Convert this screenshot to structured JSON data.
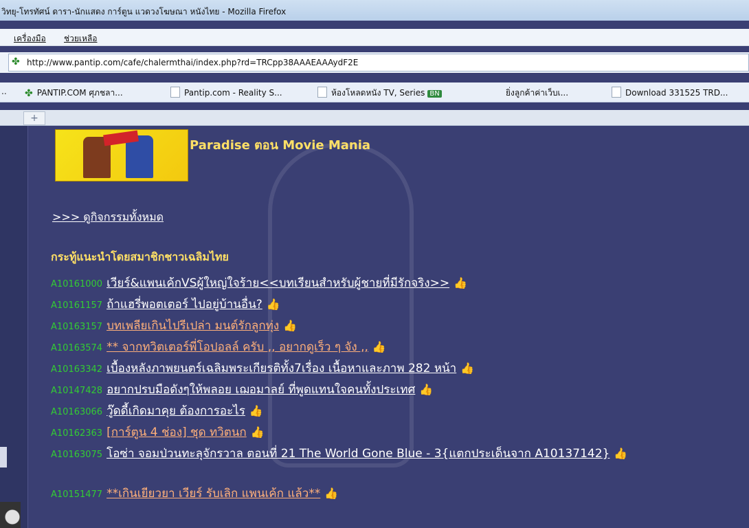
{
  "window": {
    "title": "วิทยุ-โทรทัศน์ ดารา-นักแสดง การ์ตูน แวดวงโฆษณา หนังไทย - Mozilla Firefox"
  },
  "menubar": {
    "items": [
      "เครื่องมือ",
      "ช่วยเหลือ"
    ]
  },
  "navbar": {
    "url": "http://www.pantip.com/cafe/chalermthai/index.php?rd=TRCpp38AAAEAAAydF2E"
  },
  "bookmarks": {
    "ellipsis": "..",
    "items": [
      {
        "label": "PANTIP.COM ศุภชลา...",
        "icon": "cactus-icon"
      },
      {
        "label": "Pantip.com - Reality S...",
        "icon": "page-icon"
      },
      {
        "label": "ห้องโหลดหนัง TV, Series",
        "icon": "page-icon",
        "badge": "BN"
      },
      {
        "label": "ยิ่งลูกค้าค่าเว็บเ...",
        "icon": "none"
      },
      {
        "label": "Download 331525 TRD...",
        "icon": "page-icon"
      }
    ]
  },
  "tabs": {
    "new_tab_symbol": "+"
  },
  "page": {
    "banner_title": "Paradise ตอน Movie Mania",
    "view_all_link": ">>> ดูกิจกรรมทั้งหมด",
    "section_heading": "กระทู้แนะนำโดยสมาชิกชาวเฉลิมไทย",
    "topics": [
      {
        "code": "A10161000",
        "title": "เวียร์&แพนเค้กVSผู้ใหญ่ใจร้าย<<บทเรียนสำหรับผู้ชายที่มีรักจริง>>",
        "highlight": false
      },
      {
        "code": "A10161157",
        "title": "ถ้าแฮรี่พอตเตอร์ ไปอยู่บ้านอื่น?",
        "highlight": false
      },
      {
        "code": "A10163157",
        "title": "บทเพลียเกินไปรีเปล่า มนต์รักลูกทุ่ง",
        "highlight": true
      },
      {
        "code": "A10163574",
        "title": "** จากทวิตเตอร์พี่โอปอลล์ ครับ ,, อยากดูเร็ว ๆ จัง ,,",
        "highlight": true
      },
      {
        "code": "A10163342",
        "title": "เบื้องหลังภาพยนตร์เฉลิมพระเกียรติทั้ง7เรื่อง เนื้อหาและภาพ 282 หน้า",
        "highlight": false
      },
      {
        "code": "A10147428",
        "title": "อยากปรบมือดังๆให้พลอย เฌอมาลย์ ที่พูดแทนใจคนทั้งประเทศ",
        "highlight": false
      },
      {
        "code": "A10163066",
        "title": "วู๊ดดี้เกิดมาคุย ต้องการอะไร",
        "highlight": false
      },
      {
        "code": "A10162363",
        "title": "[การ์ตูน 4 ช่อง] ชุด ทวิตนก",
        "highlight": true
      },
      {
        "code": "A10163075",
        "title": "โอซ่า จอมป่วนทะลุจักรวาล ตอนที่ 21 The World Gone Blue - 3{แตกประเด็นจาก A10137142}",
        "highlight": false
      },
      {
        "code": "A10151477",
        "title": "**เกินเยียวยา เวียร์ รับเลิก แพนเค้ก แล้ว**",
        "highlight": true
      }
    ]
  },
  "colors": {
    "page_bg": "#3a3f73",
    "heading": "#ffe066",
    "code": "#33cc33",
    "link": "#ffffff",
    "link_highlight": "#ffb07a"
  }
}
